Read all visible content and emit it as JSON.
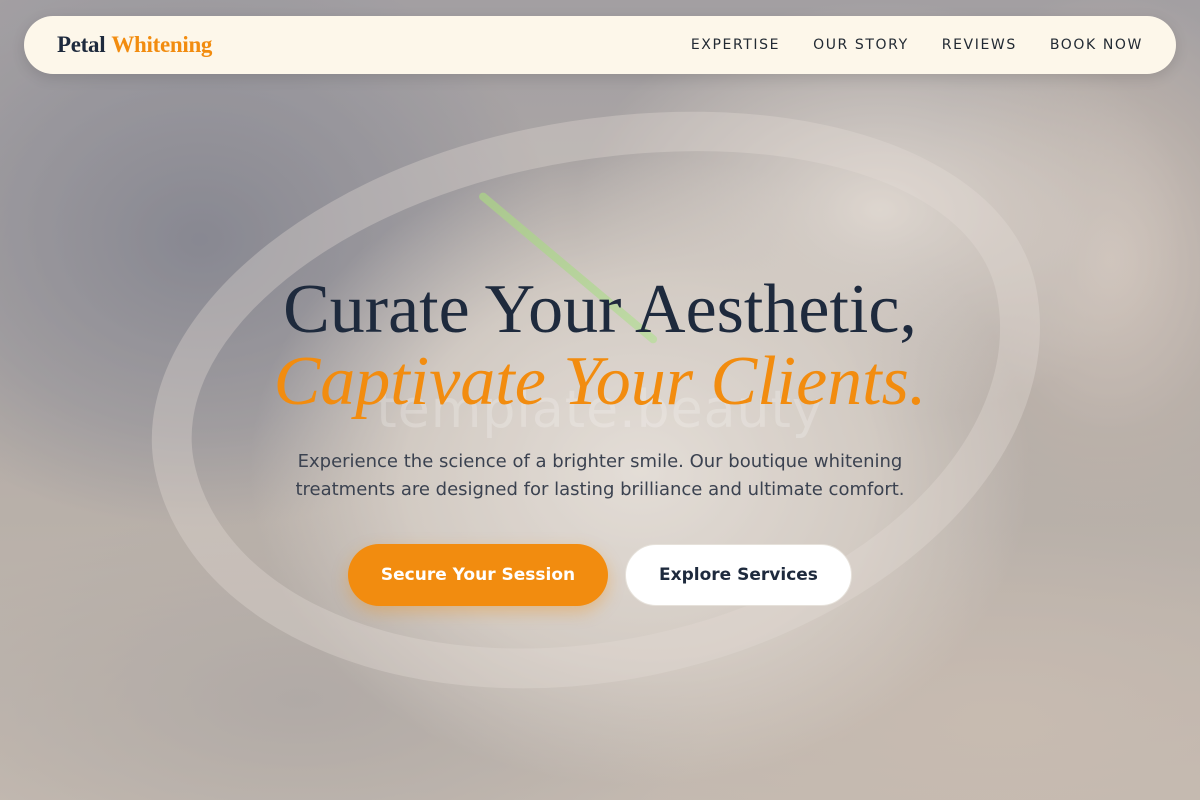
{
  "brand": {
    "primary": "Petal",
    "accent": "Whitening"
  },
  "nav": {
    "items": [
      {
        "label": "EXPERTISE"
      },
      {
        "label": "OUR STORY"
      },
      {
        "label": "REVIEWS"
      },
      {
        "label": "BOOK NOW"
      }
    ]
  },
  "hero": {
    "headline_line1": "Curate Your Aesthetic,",
    "headline_line2": "Captivate Your Clients.",
    "watermark": "template.beauty",
    "subtitle": "Experience the science of a brighter smile. Our boutique whitening treatments are designed for lasting brilliance and ultimate comfort.",
    "primary_cta": "Secure Your Session",
    "secondary_cta": "Explore Services"
  },
  "colors": {
    "accent": "#f28c0f",
    "navy": "#1e2a3d",
    "nav_background": "#fdf7ea"
  }
}
